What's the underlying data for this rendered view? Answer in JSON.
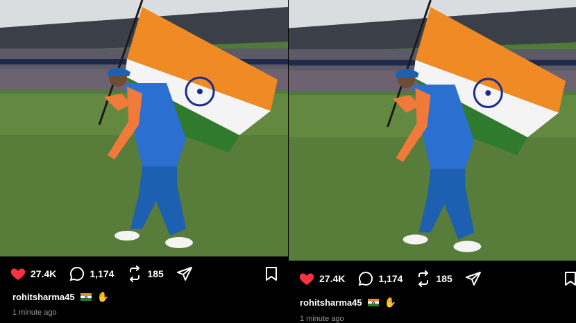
{
  "posts": [
    {
      "likes": "27.4K",
      "comments": "1,174",
      "reposts": "185",
      "username": "rohitsharma45",
      "time": "1 minute ago"
    },
    {
      "likes": "27.4K",
      "comments": "1,174",
      "reposts": "185",
      "username": "rohitsharma45",
      "time": "1 minute ago"
    }
  ],
  "icons": {
    "like": "heart-icon",
    "comment": "comment-bubble-icon",
    "repost": "repost-icon",
    "share": "send-icon",
    "save": "bookmark-icon"
  },
  "colors": {
    "background": "#000000",
    "like": "#ff3040",
    "text": "#ffffff",
    "muted": "#9a9a9a"
  }
}
